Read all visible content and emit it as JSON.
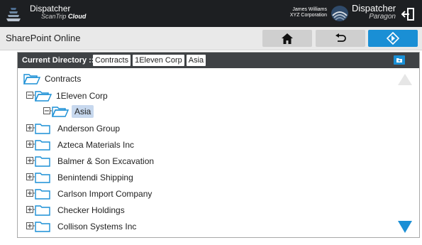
{
  "topbar": {
    "brand_left": "Dispatcher",
    "brand_left_sub": "ScanTrip",
    "brand_left_cloud": "Cloud",
    "user_name": "James Williams",
    "user_org": "XYZ Corporation",
    "brand_right": "Dispatcher",
    "brand_right_sub": "Paragon",
    "icons": [
      "dispatcher-logo-icon",
      "logout-icon"
    ]
  },
  "subbar": {
    "title": "SharePoint Online",
    "buttons": [
      {
        "name": "home",
        "icon": "home-icon"
      },
      {
        "name": "back",
        "icon": "back-icon"
      },
      {
        "name": "go",
        "icon": "diamond-arrow-icon"
      }
    ]
  },
  "panel": {
    "current_directory_label": "Current Directory ::",
    "breadcrumbs": [
      "Contracts",
      "1Eleven Corp",
      "Asia"
    ],
    "tree": [
      {
        "label": "Contracts",
        "level": 0,
        "expander": "none",
        "open": true
      },
      {
        "label": "1Eleven Corp",
        "level": 1,
        "expander": "minus",
        "open": true
      },
      {
        "label": "Asia",
        "level": 2,
        "expander": "minus",
        "open": true,
        "selected": true
      },
      {
        "label": "Anderson Group",
        "level": 1,
        "expander": "plus",
        "open": false
      },
      {
        "label": "Azteca Materials Inc",
        "level": 1,
        "expander": "plus",
        "open": false
      },
      {
        "label": "Balmer & Son Excavation",
        "level": 1,
        "expander": "plus",
        "open": false
      },
      {
        "label": "Benintendi Shipping",
        "level": 1,
        "expander": "plus",
        "open": false
      },
      {
        "label": "Carlson Import Company",
        "level": 1,
        "expander": "plus",
        "open": false
      },
      {
        "label": "Checker Holdings",
        "level": 1,
        "expander": "plus",
        "open": false
      },
      {
        "label": "Collison Systems Inc",
        "level": 1,
        "expander": "plus",
        "open": false
      }
    ]
  },
  "colors": {
    "topbar": "#1d1f22",
    "accent": "#1a8fd5",
    "panel_header": "#3f4245",
    "selected": "#c7d8ee",
    "folder": "#1a8fd5"
  }
}
